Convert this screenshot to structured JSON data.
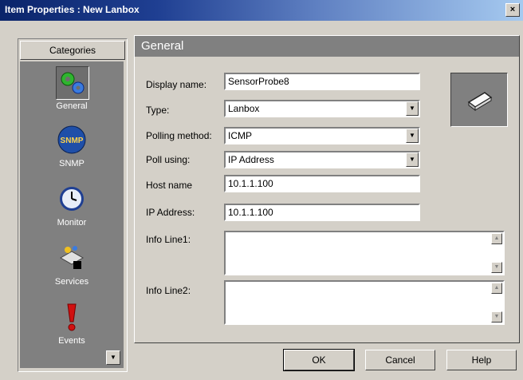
{
  "window": {
    "title": "Item Properties : New Lanbox",
    "close_label": "×"
  },
  "sidebar": {
    "header": "Categories",
    "items": [
      {
        "label": "General",
        "icon": "gears-icon",
        "selected": true
      },
      {
        "label": "SNMP",
        "icon": "snmp-icon",
        "badge": "SNMP"
      },
      {
        "label": "Monitor",
        "icon": "clock-icon"
      },
      {
        "label": "Services",
        "icon": "services-icon"
      },
      {
        "label": "Events",
        "icon": "exclamation-icon"
      }
    ]
  },
  "panel": {
    "title": "General",
    "fields": {
      "display_name": {
        "label": "Display name:",
        "value": "SensorProbe8"
      },
      "type": {
        "label": "Type:",
        "value": "Lanbox"
      },
      "polling_method": {
        "label": "Polling method:",
        "value": "ICMP"
      },
      "poll_using": {
        "label": "Poll using:",
        "value": "IP Address"
      },
      "host_name": {
        "label": "Host name",
        "value": "10.1.1.100"
      },
      "ip_address": {
        "label": "IP Address:",
        "value": "10.1.1.100"
      },
      "info_line1": {
        "label": "Info Line1:",
        "value": ""
      },
      "info_line2": {
        "label": "Info Line2:",
        "value": ""
      }
    }
  },
  "buttons": {
    "ok": "OK",
    "cancel": "Cancel",
    "help": "Help"
  },
  "colors": {
    "title_start": "#0a246a",
    "title_end": "#a6caf0",
    "face": "#d4d0c8",
    "shadow": "#808080"
  }
}
